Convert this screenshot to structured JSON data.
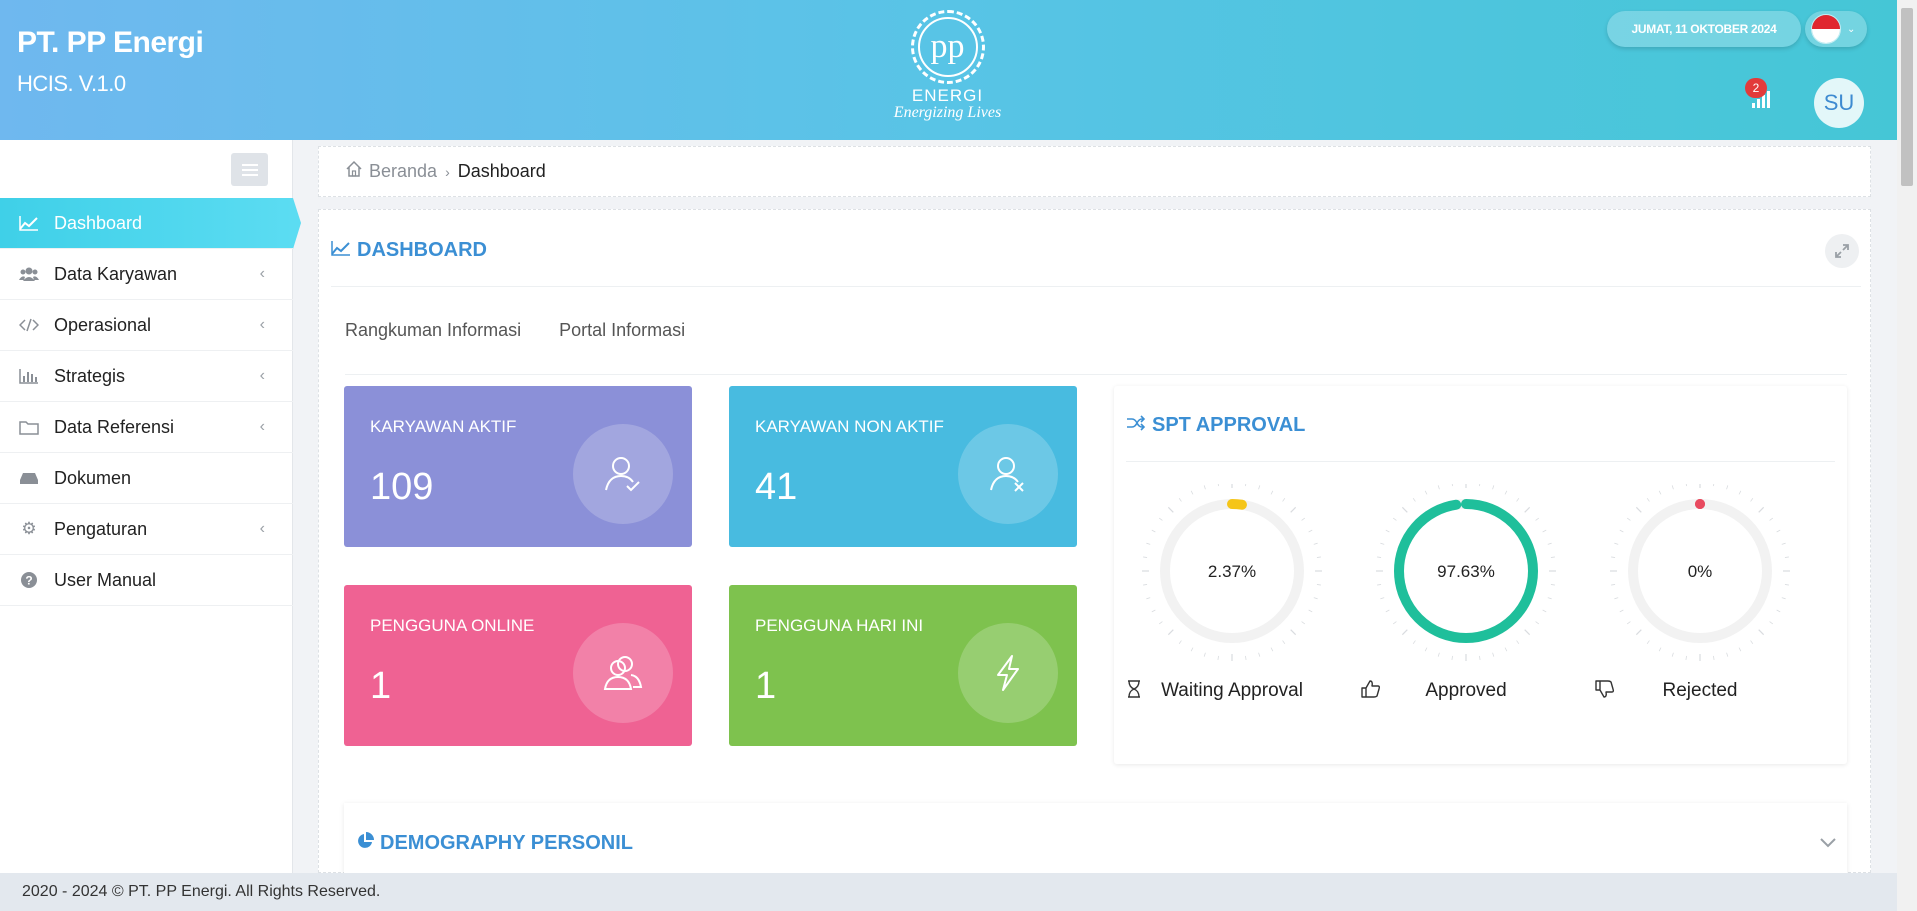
{
  "header": {
    "brand_title": "PT. PP Energi",
    "brand_subtitle": "HCIS. V.1.0",
    "logo_text": "pp",
    "logo_name": "ENERGI",
    "logo_tagline": "Energizing Lives",
    "date": "JUMAT, 11 OKTOBER 2024",
    "notification_count": "2",
    "user_initials": "SU"
  },
  "breadcrumb": {
    "home": "Beranda",
    "current": "Dashboard"
  },
  "sidebar": {
    "items": [
      {
        "label": "Dashboard",
        "icon": "line-chart-icon",
        "active": true
      },
      {
        "label": "Data Karyawan",
        "icon": "users-icon",
        "has_submenu": true
      },
      {
        "label": "Operasional",
        "icon": "code-icon",
        "has_submenu": true
      },
      {
        "label": "Strategis",
        "icon": "bar-chart-icon",
        "has_submenu": true
      },
      {
        "label": "Data Referensi",
        "icon": "folder-icon",
        "has_submenu": true
      },
      {
        "label": "Dokumen",
        "icon": "inbox-icon"
      },
      {
        "label": "Pengaturan",
        "icon": "gear-icon",
        "has_submenu": true
      },
      {
        "label": "User Manual",
        "icon": "question-icon"
      }
    ]
  },
  "panel": {
    "title": "DASHBOARD",
    "tabs": [
      "Rangkuman Informasi",
      "Portal Informasi"
    ]
  },
  "stats": [
    {
      "label": "KARYAWAN AKTIF",
      "value": "109",
      "color": "#8b90d8",
      "icon": "user-check-icon"
    },
    {
      "label": "KARYAWAN NON AKTIF",
      "value": "41",
      "color": "#48bbe0",
      "icon": "user-x-icon"
    },
    {
      "label": "PENGGUNA ONLINE",
      "value": "1",
      "color": "#ef6293",
      "icon": "users-outline-icon"
    },
    {
      "label": "PENGGUNA HARI INI",
      "value": "1",
      "color": "#7ec24e",
      "icon": "lightning-icon"
    }
  ],
  "spt_approval": {
    "title": "SPT APPROVAL",
    "gauges": [
      {
        "label": "Waiting Approval",
        "percent_text": "2.37%",
        "value": 2.37,
        "color": "#f5c518",
        "icon": "hourglass-icon"
      },
      {
        "label": "Approved",
        "percent_text": "97.63%",
        "value": 97.63,
        "color": "#1fbf9b",
        "icon": "thumbs-up-icon"
      },
      {
        "label": "Rejected",
        "percent_text": "0%",
        "value": 0,
        "color": "#e84a5f",
        "icon": "thumbs-down-icon"
      }
    ]
  },
  "demography": {
    "title": "DEMOGRAPHY PERSONIL"
  },
  "footer": {
    "text": "2020 - 2024 © PT. PP Energi. All Rights Reserved."
  }
}
